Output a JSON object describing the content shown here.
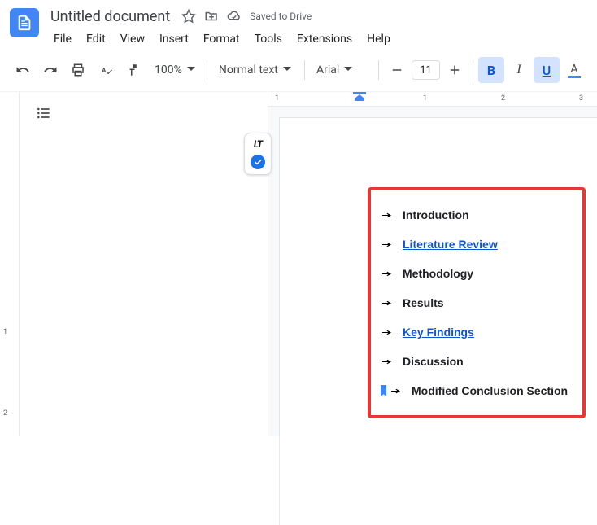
{
  "header": {
    "title": "Untitled document",
    "saved": "Saved to Drive"
  },
  "menus": [
    "File",
    "Edit",
    "View",
    "Insert",
    "Format",
    "Tools",
    "Extensions",
    "Help"
  ],
  "toolbar": {
    "zoom": "100%",
    "style": "Normal text",
    "font": "Arial",
    "font_size": "11"
  },
  "document": {
    "items": [
      {
        "text": "Introduction",
        "link": false,
        "bookmark": false
      },
      {
        "text": "Literature Review",
        "link": true,
        "bookmark": false
      },
      {
        "text": "Methodology",
        "link": false,
        "bookmark": false
      },
      {
        "text": "Results",
        "link": false,
        "bookmark": false
      },
      {
        "text": "Key Findings",
        "link": true,
        "bookmark": false
      },
      {
        "text": "Discussion",
        "link": false,
        "bookmark": false
      },
      {
        "text": "Modified Conclusion Section",
        "link": false,
        "bookmark": true
      }
    ]
  },
  "hruler_marks": [
    {
      "label": "1",
      "pos": 8
    },
    {
      "label": "1",
      "pos": 190
    },
    {
      "label": "2",
      "pos": 286
    },
    {
      "label": "3",
      "pos": 382
    }
  ],
  "vruler_marks": [
    {
      "label": "1",
      "pos": 290
    },
    {
      "label": "2",
      "pos": 390
    }
  ]
}
